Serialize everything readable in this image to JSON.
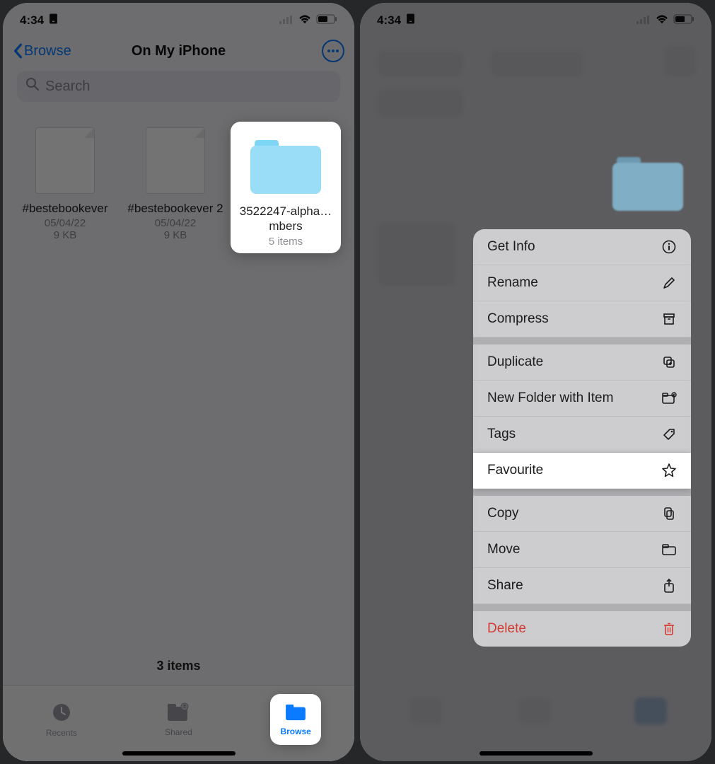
{
  "status": {
    "time": "4:34"
  },
  "nav": {
    "back": "Browse",
    "title": "On My iPhone"
  },
  "search": {
    "placeholder": "Search"
  },
  "files": [
    {
      "name": "#bestebookever",
      "date": "05/04/22",
      "size": "9 KB"
    },
    {
      "name": "#bestebookever 2",
      "date": "05/04/22",
      "size": "9 KB"
    },
    {
      "name": "3522247-alpha…mbers",
      "meta": "5 items"
    }
  ],
  "footer": {
    "count": "3 items"
  },
  "tabs": {
    "recents": "Recents",
    "shared": "Shared",
    "browse": "Browse"
  },
  "menu": {
    "getinfo": "Get Info",
    "rename": "Rename",
    "compress": "Compress",
    "duplicate": "Duplicate",
    "newfolder": "New Folder with Item",
    "tags": "Tags",
    "favourite": "Favourite",
    "copy": "Copy",
    "move": "Move",
    "share": "Share",
    "delete": "Delete"
  }
}
